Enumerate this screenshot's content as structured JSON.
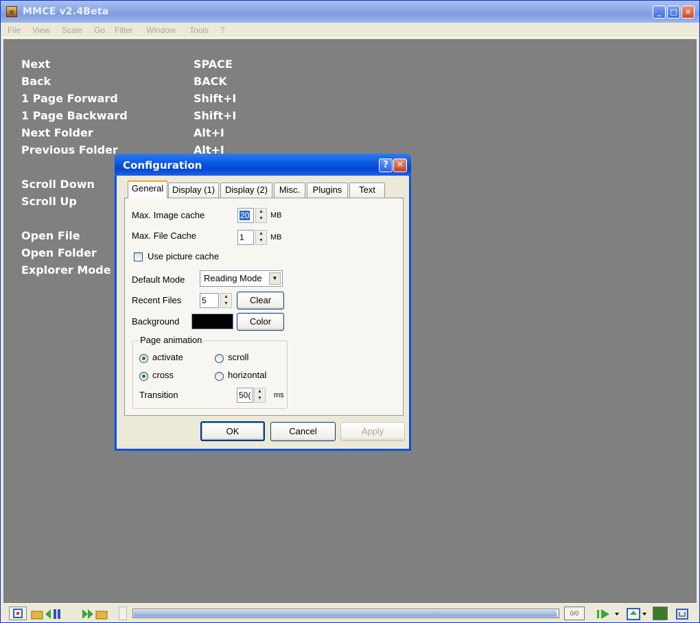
{
  "window": {
    "title": "MMCE v2.4Beta",
    "controls": {
      "minimize": "_",
      "maximize": "□",
      "close": "✕"
    }
  },
  "menu": [
    "File",
    "View",
    "Scale",
    "Go",
    "Filter",
    "Window",
    "Tools",
    "?"
  ],
  "help": {
    "groups": [
      [
        {
          "action": "Next",
          "key": "SPACE"
        },
        {
          "action": "Back",
          "key": "BACK"
        },
        {
          "action": "1 Page Forward",
          "key": "Shift+I"
        },
        {
          "action": "1 Page Backward",
          "key": "Shift+I"
        },
        {
          "action": "Next Folder",
          "key": "Alt+I"
        },
        {
          "action": "Previous Folder",
          "key": "Alt+I"
        }
      ],
      [
        {
          "action": "Scroll Down"
        },
        {
          "action": "Scroll Up"
        }
      ],
      [
        {
          "action": "Open File"
        },
        {
          "action": "Open Folder"
        },
        {
          "action": "Explorer Mode"
        }
      ]
    ]
  },
  "dialog": {
    "title": "Configuration",
    "help_btn": "?",
    "close_btn": "✕",
    "tabs": [
      "General",
      "Display (1)",
      "Display (2)",
      "Misc.",
      "Plugins",
      "Text"
    ],
    "active_tab": "General",
    "general": {
      "image_cache_label": "Max. Image cache",
      "image_cache_value": "20",
      "image_cache_unit": "MB",
      "file_cache_label": "Max. File Cache",
      "file_cache_value": "1",
      "file_cache_unit": "MB",
      "use_picture_cache_label": "Use picture cache",
      "use_picture_cache_checked": false,
      "default_mode_label": "Default Mode",
      "default_mode_value": "Reading Mode",
      "recent_files_label": "Recent Files",
      "recent_files_value": "5",
      "clear_button": "Clear",
      "background_label": "Background",
      "background_color": "#000000",
      "color_button": "Color",
      "page_animation": {
        "legend": "Page animation",
        "options": [
          "activate",
          "scroll",
          "cross",
          "horizontal"
        ],
        "selected": [
          "activate",
          "cross"
        ],
        "transition_label": "Transition",
        "transition_value": "50(",
        "transition_unit": "ms"
      }
    },
    "buttons": {
      "ok": "OK",
      "cancel": "Cancel",
      "apply": "Apply"
    }
  },
  "statusbar": {
    "page_counter": "0/0"
  },
  "colors": {
    "background": "#808080",
    "dialog_border": "#0a50e8",
    "chrome": "#ece9d8"
  }
}
